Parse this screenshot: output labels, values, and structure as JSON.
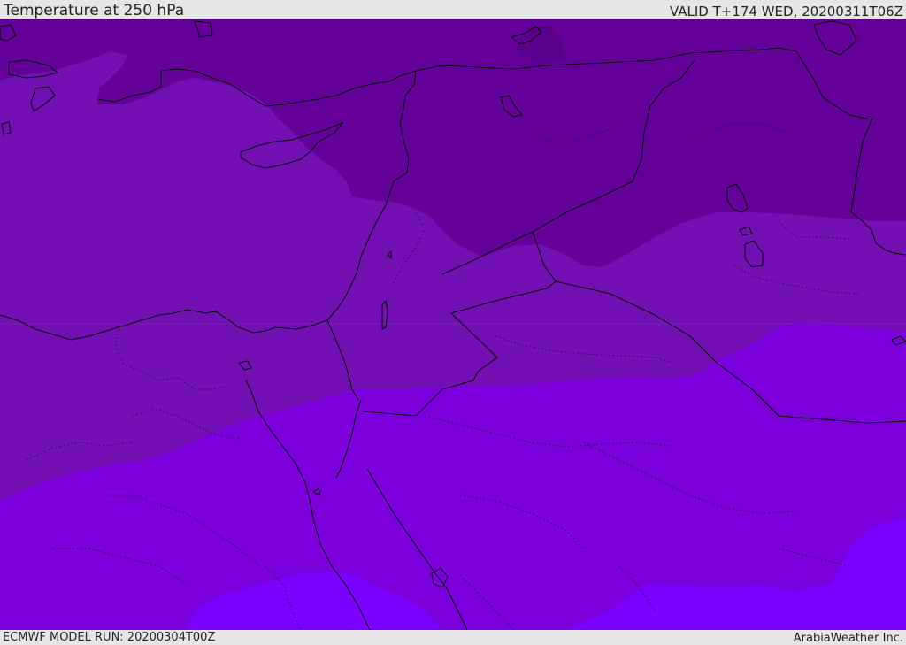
{
  "header": {
    "title": "Temperature at 250 hPa",
    "valid": "VALID T+174 WED, 20200311T06Z"
  },
  "footer": {
    "model_run": "ECMWF MODEL RUN: 20200304T00Z",
    "credit": "ArabiaWeather Inc."
  },
  "map": {
    "field": "temperature_250hPa",
    "region": "Eastern Mediterranean / Middle East",
    "colors": {
      "darkest": "#630099",
      "dark": "#7210b4",
      "medium": "#7b00dc",
      "light": "#7b00ff",
      "coastline": "#000000"
    }
  }
}
